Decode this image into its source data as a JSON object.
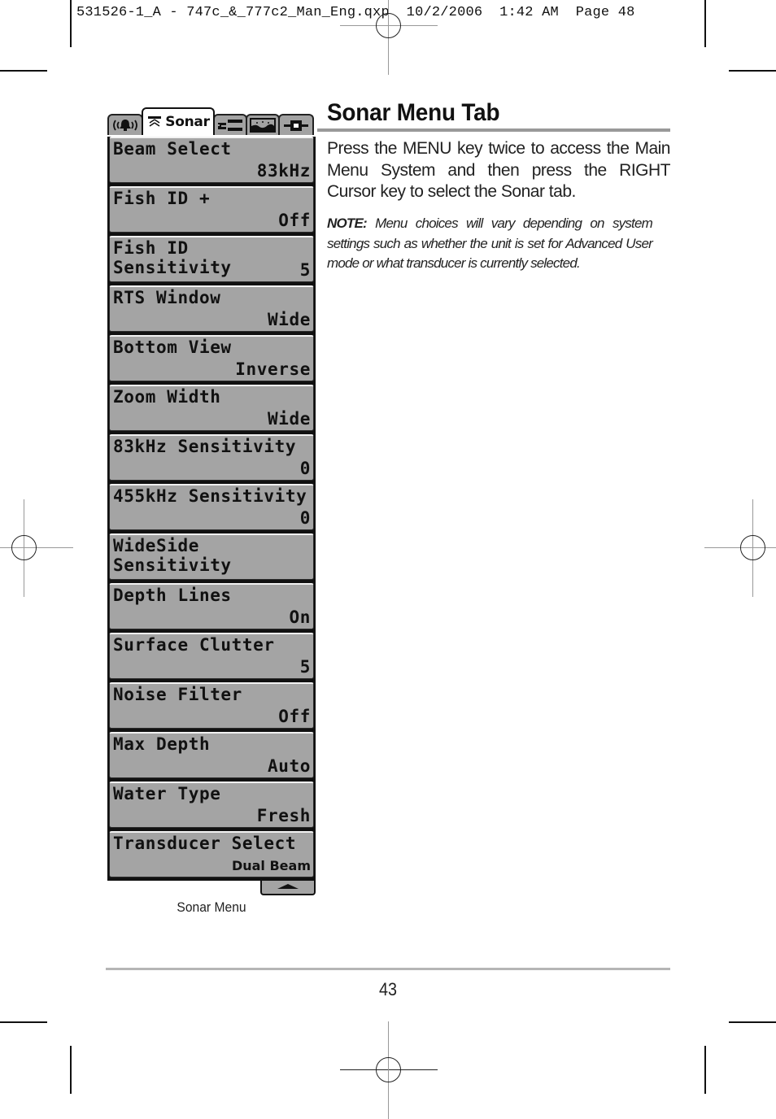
{
  "print_slug": "531526-1_A - 747c_&_777c2_Man_Eng.qxp  10/2/2006  1:42 AM  Page 48",
  "menu": {
    "tabs": [
      {
        "icon": "alarm-bell-icon",
        "label": ""
      },
      {
        "icon": "sonar-icon",
        "label": "Sonar",
        "active": true
      },
      {
        "icon": "setup-wrench-icon",
        "label": ""
      },
      {
        "icon": "views-terrain-icon",
        "label": ""
      },
      {
        "icon": "accessories-plug-icon",
        "label": ""
      }
    ],
    "items": [
      {
        "name": "Beam Select",
        "value": "83kHz"
      },
      {
        "name": "Fish ID +",
        "value": "Off"
      },
      {
        "name": "Fish ID Sensitivity",
        "value": "5"
      },
      {
        "name": "RTS Window",
        "value": "Wide"
      },
      {
        "name": "Bottom View",
        "value": "Inverse"
      },
      {
        "name": "Zoom Width",
        "value": "Wide"
      },
      {
        "name": "83kHz Sensitivity",
        "value": "0"
      },
      {
        "name": "455kHz Sensitivity",
        "value": "0"
      },
      {
        "name": "WideSide Sensitivity",
        "value": ""
      },
      {
        "name": "Depth Lines",
        "value": "On"
      },
      {
        "name": "Surface Clutter",
        "value": "5"
      },
      {
        "name": "Noise Filter",
        "value": "Off"
      },
      {
        "name": "Max Depth",
        "value": "Auto"
      },
      {
        "name": "Water Type",
        "value": "Fresh"
      },
      {
        "name": "Transducer Select",
        "value": "Dual Beam"
      }
    ],
    "scroll_icon": "scroll-up-arrow-icon",
    "caption": "Sonar Menu"
  },
  "content": {
    "heading": "Sonar Menu Tab",
    "body": "Press the MENU key twice to access the Main Menu System and then press the RIGHT Cursor key to select the Sonar tab.",
    "note_label": "NOTE:",
    "note_text": " Menu choices will vary depending on system settings such as whether the unit is set for Advanced User mode or what transducer is currently selected."
  },
  "footer": {
    "page_number": "43"
  },
  "colors": {
    "menu_gray": "#a4a4a4",
    "rule_gray": "#999999"
  }
}
